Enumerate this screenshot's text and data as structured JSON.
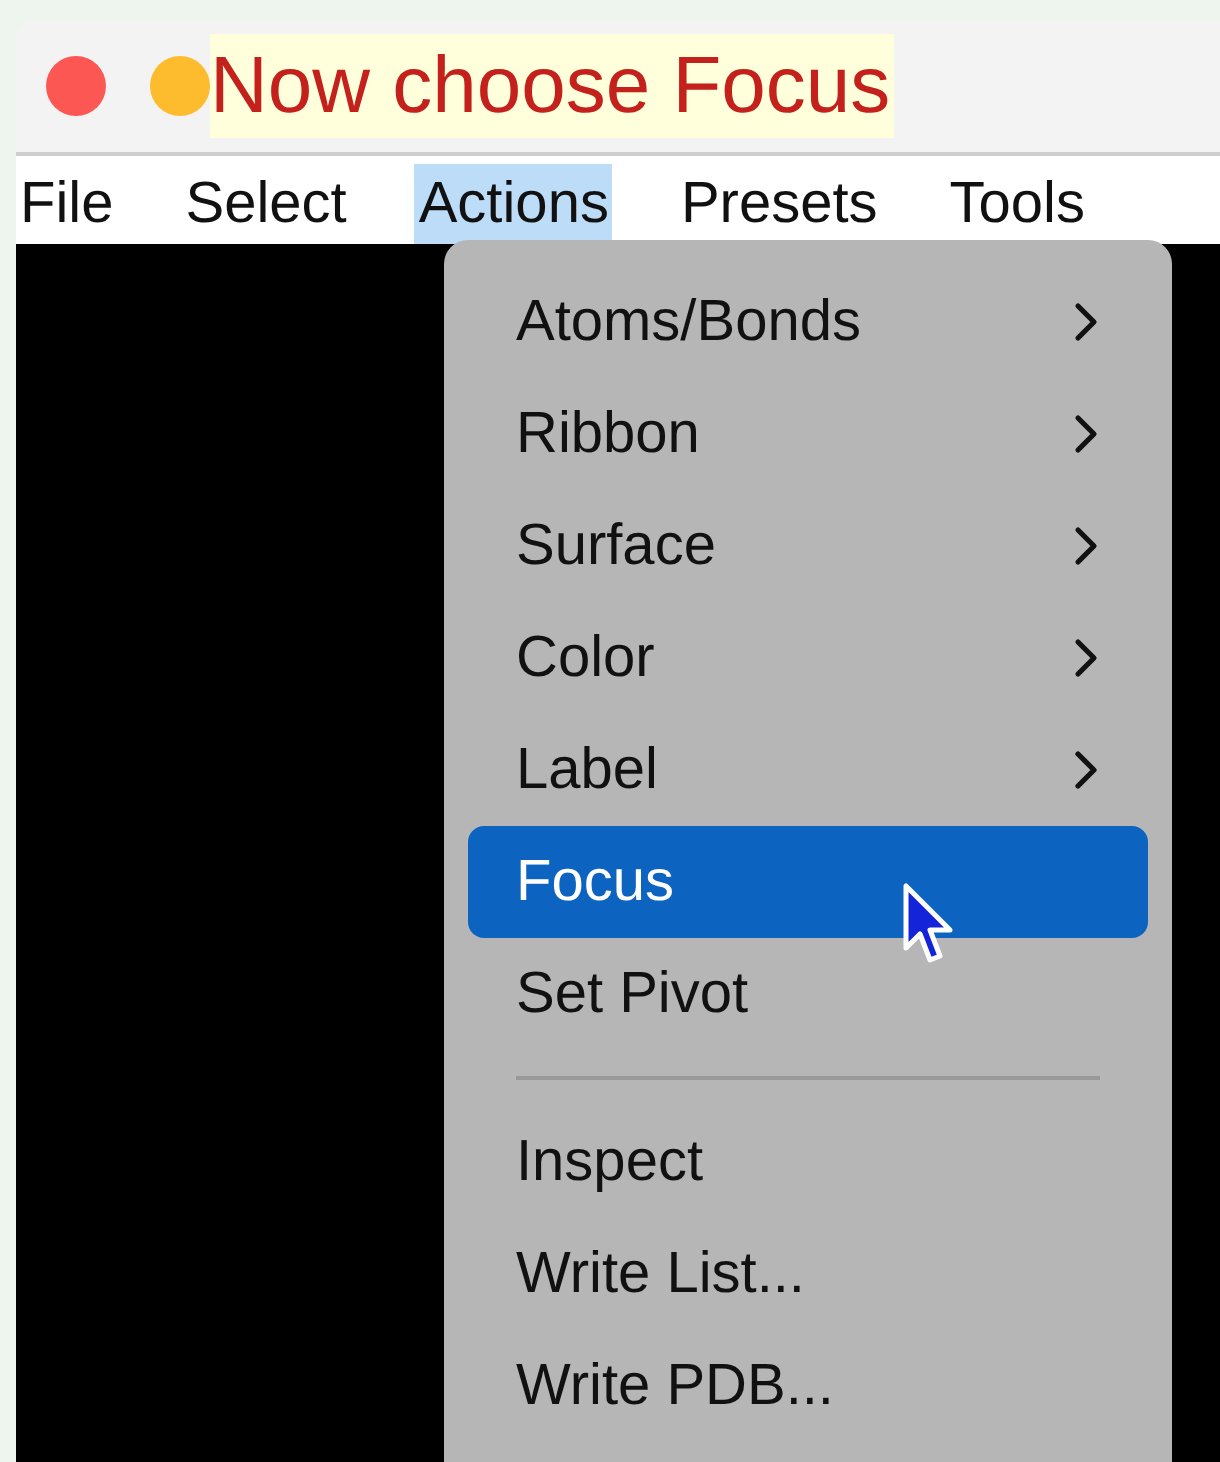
{
  "caption": "Now choose Focus",
  "menu_bar": [
    {
      "label": "File",
      "selected": false
    },
    {
      "label": "Select",
      "selected": false
    },
    {
      "label": "Actions",
      "selected": true
    },
    {
      "label": "Presets",
      "selected": false
    },
    {
      "label": "Tools",
      "selected": false
    }
  ],
  "dropdown": {
    "sections": [
      [
        {
          "label": "Atoms/Bonds",
          "submenu": true,
          "selected": false
        },
        {
          "label": "Ribbon",
          "submenu": true,
          "selected": false
        },
        {
          "label": "Surface",
          "submenu": true,
          "selected": false
        },
        {
          "label": "Color",
          "submenu": true,
          "selected": false
        },
        {
          "label": "Label",
          "submenu": true,
          "selected": false
        },
        {
          "label": "Focus",
          "submenu": false,
          "selected": true
        },
        {
          "label": "Set Pivot",
          "submenu": false,
          "selected": false
        }
      ],
      [
        {
          "label": "Inspect",
          "submenu": false,
          "selected": false
        },
        {
          "label": "Write List...",
          "submenu": false,
          "selected": false
        },
        {
          "label": "Write PDB...",
          "submenu": false,
          "selected": false
        }
      ]
    ]
  }
}
